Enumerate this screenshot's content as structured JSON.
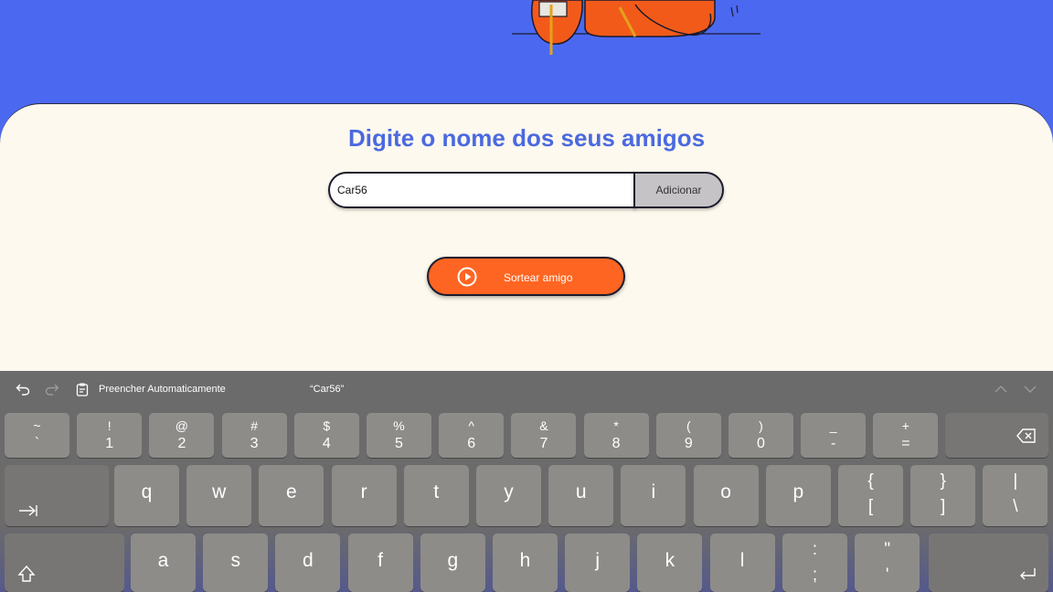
{
  "page": {
    "title": "Digite o nome dos seus amigos",
    "name_input_value": "Car56",
    "add_button": "Adicionar",
    "draw_button": "Sortear amigo"
  },
  "colors": {
    "background_blue": "#4b69f0",
    "card": "#fdf9ee",
    "title": "#4b69e0",
    "draw_button": "#fe6522",
    "add_button": "#c6c3c6"
  },
  "keyboard": {
    "toolbar": {
      "undo_icon": "undo-icon",
      "redo_icon": "redo-icon",
      "clipboard_icon": "clipboard-icon",
      "autofill": "Preencher Automaticamente",
      "suggestion": "“Car56”",
      "up_icon": "chevron-up-icon",
      "down_icon": "chevron-down-icon"
    },
    "number_row": [
      {
        "top": "~",
        "bottom": "`"
      },
      {
        "top": "!",
        "bottom": "1"
      },
      {
        "top": "@",
        "bottom": "2"
      },
      {
        "top": "#",
        "bottom": "3"
      },
      {
        "top": "$",
        "bottom": "4"
      },
      {
        "top": "%",
        "bottom": "5"
      },
      {
        "top": "^",
        "bottom": "6"
      },
      {
        "top": "&",
        "bottom": "7"
      },
      {
        "top": "*",
        "bottom": "8"
      },
      {
        "top": "(",
        "bottom": "9"
      },
      {
        "top": ")",
        "bottom": "0"
      },
      {
        "top": "_",
        "bottom": "-"
      },
      {
        "top": "+",
        "bottom": "="
      }
    ],
    "qwerty_row": [
      "q",
      "w",
      "e",
      "r",
      "t",
      "y",
      "u",
      "i",
      "o",
      "p"
    ],
    "qwerty_pairs": [
      {
        "top": "{",
        "bottom": "["
      },
      {
        "top": "}",
        "bottom": "]"
      },
      {
        "top": "|",
        "bottom": "\\"
      }
    ],
    "home_row": [
      "a",
      "s",
      "d",
      "f",
      "g",
      "h",
      "j",
      "k",
      "l"
    ],
    "home_pairs": [
      {
        "top": ":",
        "bottom": ";"
      },
      {
        "top": "\"",
        "bottom": "'"
      }
    ],
    "special_icons": {
      "delete": "delete-icon",
      "tab": "tab-icon",
      "shift": "shift-icon",
      "return": "return-icon"
    }
  }
}
